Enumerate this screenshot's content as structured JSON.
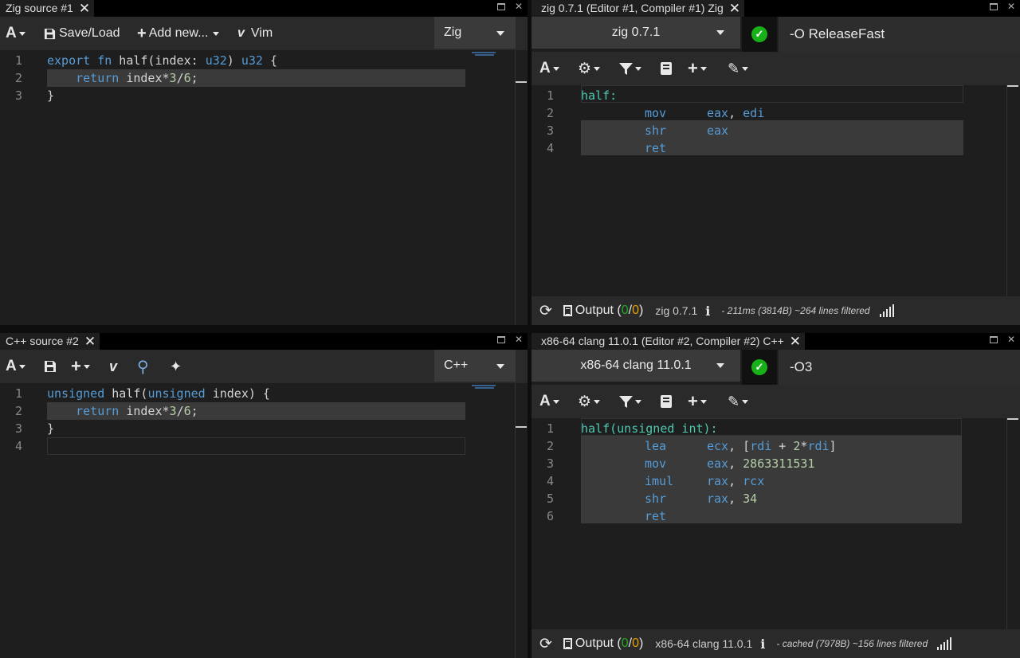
{
  "zig_source": {
    "tab_title": "Zig source #1",
    "toolbar": {
      "save_load": "Save/Load",
      "add_new": "Add new...",
      "vim": "Vim"
    },
    "language": "Zig",
    "lines": [
      {
        "n": "1",
        "parts": [
          [
            "kw",
            "export"
          ],
          [
            "t",
            " "
          ],
          [
            "kw",
            "fn"
          ],
          [
            "t",
            " half(index: "
          ],
          [
            "kw",
            "u32"
          ],
          [
            "t",
            ") "
          ],
          [
            "kw",
            "u32"
          ],
          [
            "t",
            " {"
          ]
        ]
      },
      {
        "n": "2",
        "parts": [
          [
            "t",
            "    "
          ],
          [
            "kw",
            "return"
          ],
          [
            "t",
            " index*"
          ],
          [
            "num",
            "3"
          ],
          [
            "t",
            "/"
          ],
          [
            "num",
            "6"
          ],
          [
            "t",
            ";"
          ]
        ]
      },
      {
        "n": "3",
        "parts": [
          [
            "t",
            "}"
          ]
        ]
      }
    ]
  },
  "zig_compiler": {
    "tab_title": "zig 0.7.1 (Editor #1, Compiler #1) Zig",
    "compiler": "zig 0.7.1",
    "options": "-O ReleaseFast",
    "asm": [
      {
        "n": "1",
        "label": "half:"
      },
      {
        "n": "2",
        "mnem": "mov",
        "ops": [
          [
            "reg",
            "eax"
          ],
          [
            "t",
            ", "
          ],
          [
            "reg",
            "edi"
          ]
        ]
      },
      {
        "n": "3",
        "mnem": "shr",
        "ops": [
          [
            "reg",
            "eax"
          ]
        ]
      },
      {
        "n": "4",
        "mnem": "ret",
        "ops": []
      }
    ],
    "output": "Output",
    "out_a": "0",
    "out_b": "0",
    "compiler_name": "zig 0.7.1",
    "stats": "- 211ms (3814B) ~264 lines filtered"
  },
  "cpp_source": {
    "tab_title": "C++ source #2",
    "language": "C++",
    "lines": [
      {
        "n": "1",
        "parts": [
          [
            "kw",
            "unsigned"
          ],
          [
            "t",
            " half("
          ],
          [
            "kw",
            "unsigned"
          ],
          [
            "t",
            " index) {"
          ]
        ]
      },
      {
        "n": "2",
        "parts": [
          [
            "t",
            "    "
          ],
          [
            "kw",
            "return"
          ],
          [
            "t",
            " index*"
          ],
          [
            "num",
            "3"
          ],
          [
            "t",
            "/"
          ],
          [
            "num",
            "6"
          ],
          [
            "t",
            ";"
          ]
        ]
      },
      {
        "n": "3",
        "parts": [
          [
            "t",
            "}"
          ]
        ]
      },
      {
        "n": "4",
        "parts": []
      }
    ]
  },
  "cpp_compiler": {
    "tab_title": "x86-64 clang 11.0.1 (Editor #2, Compiler #2) C++",
    "compiler": "x86-64 clang 11.0.1",
    "options": "-O3",
    "asm": [
      {
        "n": "1",
        "label": "half(unsigned int):"
      },
      {
        "n": "2",
        "mnem": "lea",
        "ops": [
          [
            "reg",
            "ecx"
          ],
          [
            "t",
            ", ["
          ],
          [
            "reg",
            "rdi"
          ],
          [
            "t",
            " + "
          ],
          [
            "num",
            "2"
          ],
          [
            "t",
            "*"
          ],
          [
            "reg",
            "rdi"
          ],
          [
            "t",
            "]"
          ]
        ]
      },
      {
        "n": "3",
        "mnem": "mov",
        "ops": [
          [
            "reg",
            "eax"
          ],
          [
            "t",
            ", "
          ],
          [
            "num",
            "2863311531"
          ]
        ]
      },
      {
        "n": "4",
        "mnem": "imul",
        "ops": [
          [
            "reg",
            "rax"
          ],
          [
            "t",
            ", "
          ],
          [
            "reg",
            "rcx"
          ]
        ]
      },
      {
        "n": "5",
        "mnem": "shr",
        "ops": [
          [
            "reg",
            "rax"
          ],
          [
            "t",
            ", "
          ],
          [
            "num",
            "34"
          ]
        ]
      },
      {
        "n": "6",
        "mnem": "ret",
        "ops": []
      }
    ],
    "output": "Output",
    "out_a": "0",
    "out_b": "0",
    "compiler_name": "x86-64 clang 11.0.1",
    "stats": "- cached (7978B) ~156 lines filtered"
  },
  "icons": {
    "font": "A",
    "refresh": "⟳",
    "info": "i",
    "close": "✕",
    "check": "✓",
    "plus": "+",
    "vim_glyph": "v",
    "gear": "⚙",
    "filter": "▼",
    "book": "▮",
    "brush": "✎",
    "zoom": "⚲",
    "pin": "✦"
  }
}
